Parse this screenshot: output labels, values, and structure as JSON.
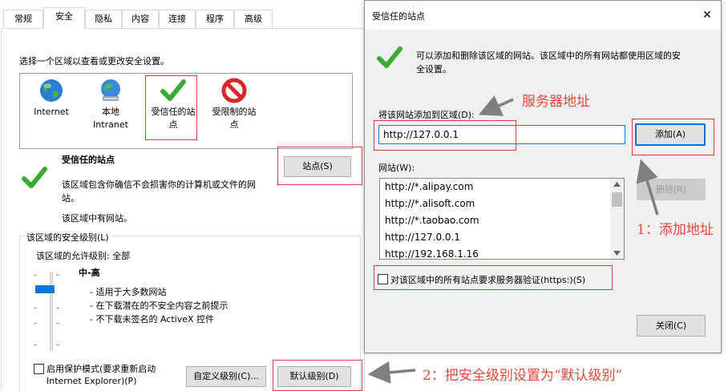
{
  "tabs": [
    {
      "label": "常规"
    },
    {
      "label": "安全"
    },
    {
      "label": "隐私"
    },
    {
      "label": "内容"
    },
    {
      "label": "连接"
    },
    {
      "label": "程序"
    },
    {
      "label": "高级"
    }
  ],
  "security": {
    "instruction": "选择一个区域以查看或更改安全设置。",
    "zones": [
      {
        "line1": "Internet",
        "line2": "",
        "icon": "globe-icon"
      },
      {
        "line1": "本地",
        "line2": "Intranet",
        "icon": "intranet-globe-icon"
      },
      {
        "line1": "受信任的站",
        "line2": "点",
        "icon": "green-check-icon"
      },
      {
        "line1": "受限制的站",
        "line2": "点",
        "icon": "no-entry-icon"
      }
    ],
    "zone_title": "受信任的站点",
    "zone_desc_1": "该区域包含你确信不会损害你的计算机或文件的网",
    "zone_desc_2": "站。",
    "zone_has_sites": "该区域中有网站。",
    "sites_button": "站点(S)",
    "level_group_title": "该区域的安全级别(L)",
    "allowed_levels": "该区域的允许级别: 全部",
    "level_name": "中-高",
    "level_bullets": [
      "- 适用于大多数网站",
      "- 在下载潜在的不安全内容之前提示",
      "- 不下载未签名的 ActiveX 控件"
    ],
    "protected_mode_1": "启用保护模式(要求重新启动",
    "protected_mode_2": "Internet Explorer)(P)",
    "custom_level_button": "自定义级别(C)...",
    "default_level_button": "默认级别(D)"
  },
  "dialog": {
    "title": "受信任的站点",
    "close_glyph": "✕",
    "info_1": "可以添加和删除该区域的网站。该区域中的所有网站都使用区域的安",
    "info_2": "全设置。",
    "add_label": "将该网站添加到区域(D):",
    "add_value": "http://127.0.0.1",
    "add_button": "添加(A)",
    "sites_label": "网站(W):",
    "sites": [
      "http://*.alipay.com",
      "http://*.alisoft.com",
      "http://*.taobao.com",
      "http://127.0.0.1",
      "http://192.168.1.16"
    ],
    "remove_button": "删除(R)",
    "https_checkbox": "对该区域中的所有站点要求服务器验证(https:)(S)",
    "close_button": "关闭(C)"
  },
  "annotations": {
    "server_address": "服务器地址",
    "step1": "1：添加地址",
    "step2": "2：把安全级别设置为“默认级别”"
  },
  "colors": {
    "annotation_red": "#e8473b",
    "focus_blue": "#0078d7",
    "check_green": "#3aaa35",
    "arrow_gray": "#7f7f7f"
  }
}
